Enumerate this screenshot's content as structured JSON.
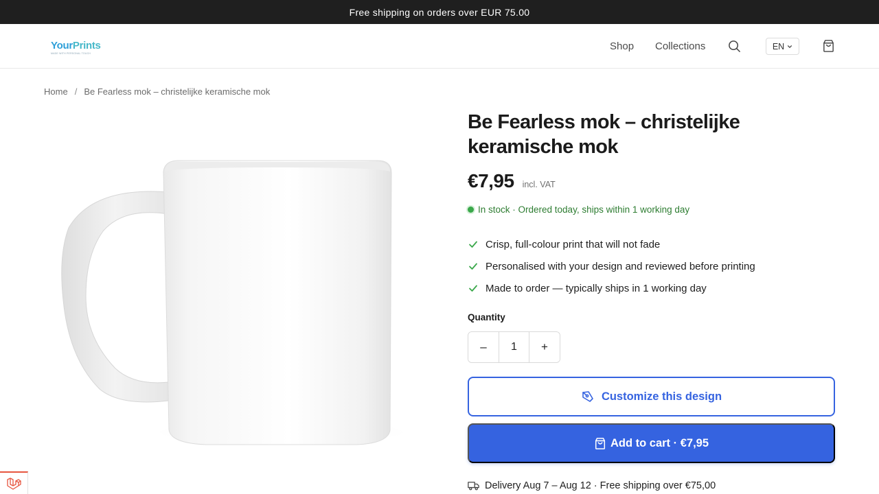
{
  "announcement": "Free shipping on orders over EUR 75.00",
  "brand": {
    "part1": "Your",
    "part2": "Prints",
    "tagline": "MADE WITH PERSONAL TOUCH"
  },
  "nav": {
    "shop": "Shop",
    "collections": "Collections",
    "language": "EN"
  },
  "breadcrumb": {
    "home": "Home",
    "separator": "/",
    "current": "Be Fearless mok – christelijke keramische mok"
  },
  "product": {
    "title": "Be Fearless mok – christelijke keramische mok",
    "price": "€7,95",
    "vat_note": "incl. VAT",
    "stock": "In stock · Ordered today, ships within 1 working day",
    "features": [
      "Crisp, full-colour print that will not fade",
      "Personalised with your design and reviewed before printing",
      "Made to order — typically ships in 1 working day"
    ],
    "quantity_label": "Quantity",
    "quantity": "1",
    "decrease": "–",
    "increase": "+",
    "customize_label": "Customize this design",
    "add_to_cart_label": "Add to cart · €7,95",
    "delivery": "Delivery Aug 7 – Aug 12 · Free shipping over €75,00"
  },
  "colors": {
    "accent": "#3563e0",
    "stock_green": "#2e7d32",
    "announcement_bg": "#1f1f1f"
  },
  "icons": [
    "search-icon",
    "chevron-down-icon",
    "shopping-bag-icon",
    "check-icon",
    "pen-tool-icon",
    "truck-icon",
    "laravel-icon"
  ]
}
